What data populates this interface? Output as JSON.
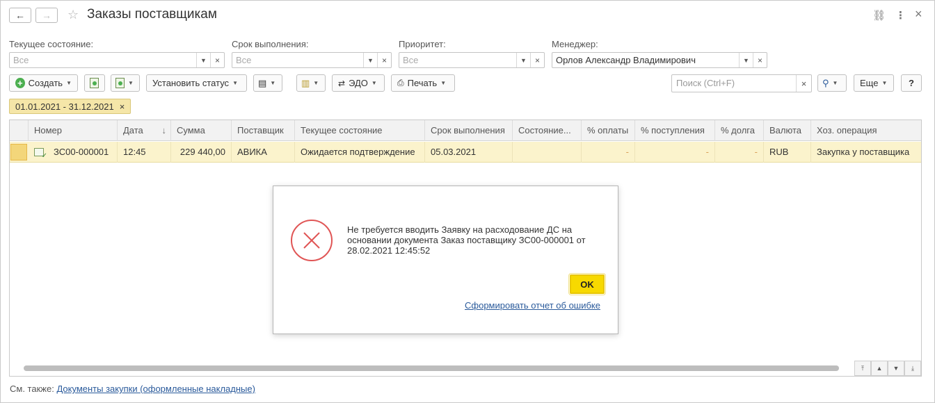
{
  "window": {
    "title": "Заказы поставщикам",
    "back_icon": "←",
    "forward_icon": "→",
    "star_icon": "☆",
    "link_icon": "⛓",
    "menu_icon": "⋮",
    "close_icon": "×"
  },
  "filters": [
    {
      "label": "Текущее состояние:",
      "value": "Все"
    },
    {
      "label": "Срок выполнения:",
      "value": "Все"
    },
    {
      "label": "Приоритет:",
      "value": "Все"
    },
    {
      "label": "Менеджер:",
      "value": "Орлов Александр Владимирович"
    }
  ],
  "toolbar": {
    "create_label": "Создать",
    "set_status_label": "Установить статус",
    "edo_label": "ЭДО",
    "print_label": "Печать",
    "search_placeholder": "Поиск (Ctrl+F)",
    "more_label": "Еще",
    "help_label": "?"
  },
  "period": {
    "label": "01.01.2021 - 31.12.2021"
  },
  "table": {
    "columns": [
      "Номер",
      "Дата",
      "Сумма",
      "Поставщик",
      "Текущее состояние",
      "Срок выполнения",
      "Состояние...",
      "% оплаты",
      "% поступления",
      "% долга",
      "Валюта",
      "Хоз. операция"
    ],
    "sort_indicator": "↓",
    "rows": [
      {
        "number": "ЗС00-000001",
        "date": "12:45",
        "sum": "229 440,00",
        "supplier": "АВИКА",
        "state": "Ожидается подтверждение",
        "due": "05.03.2021",
        "state2": "",
        "pay_pct": "-",
        "receipt_pct": "-",
        "debt_pct": "-",
        "currency": "RUB",
        "operation": "Закупка у поставщика"
      }
    ]
  },
  "dialog": {
    "message": "Не требуется вводить Заявку на расходование ДС на основании документа Заказ поставщику ЗС00-000001 от 28.02.2021 12:45:52",
    "ok_label": "OK",
    "report_link": "Сформировать отчет об ошибке",
    "error_color": "#e05555"
  },
  "footer": {
    "prefix": "См. также:",
    "link": "Документы закупки (оформленные накладные)"
  }
}
